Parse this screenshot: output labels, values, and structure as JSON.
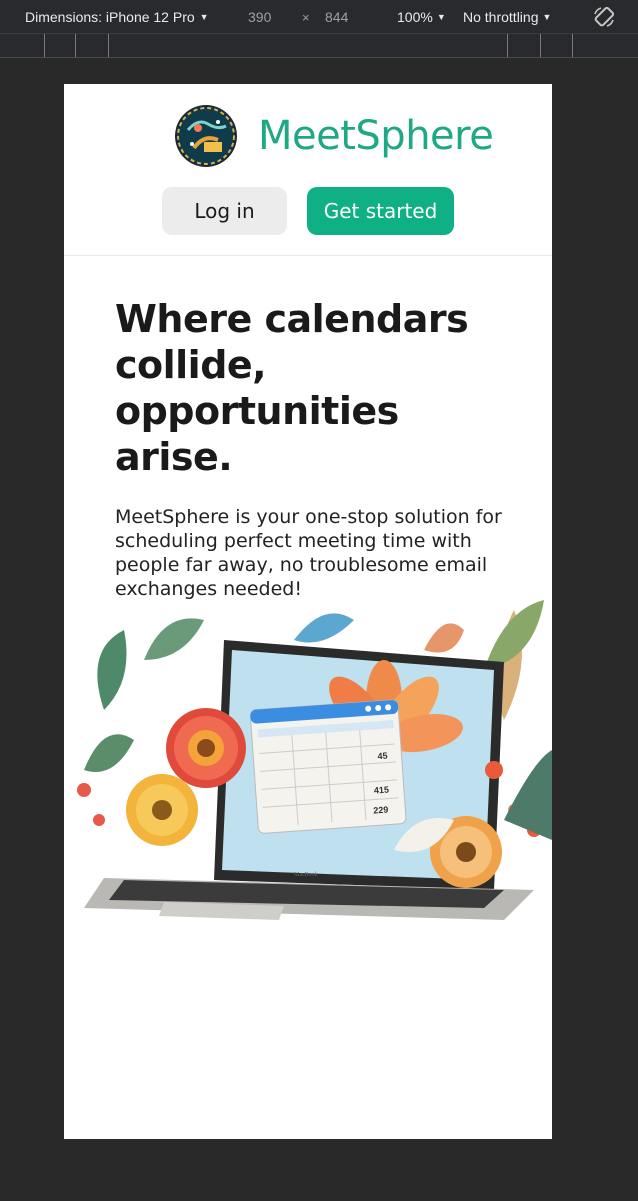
{
  "devtools": {
    "dimensions_label": "Dimensions: iPhone 12 Pro",
    "width": "390",
    "times": "×",
    "height": "844",
    "zoom": "100%",
    "throttling": "No throttling"
  },
  "header": {
    "brand_name": "MeetSphere",
    "login_label": "Log in",
    "get_started_label": "Get started"
  },
  "hero": {
    "title": "Where calendars collide, opportunities arise.",
    "subtitle": "MeetSphere is your one-stop solution for scheduling perfect meeting time with people far away, no troublesome email exchanges needed!"
  },
  "illustration": {
    "laptop_brand": "MacBook",
    "calendar_numbers": [
      "45",
      "415",
      "229"
    ]
  },
  "colors": {
    "brand": "#1fa884",
    "cta": "#0fb184",
    "secondary_button": "#ececec"
  }
}
